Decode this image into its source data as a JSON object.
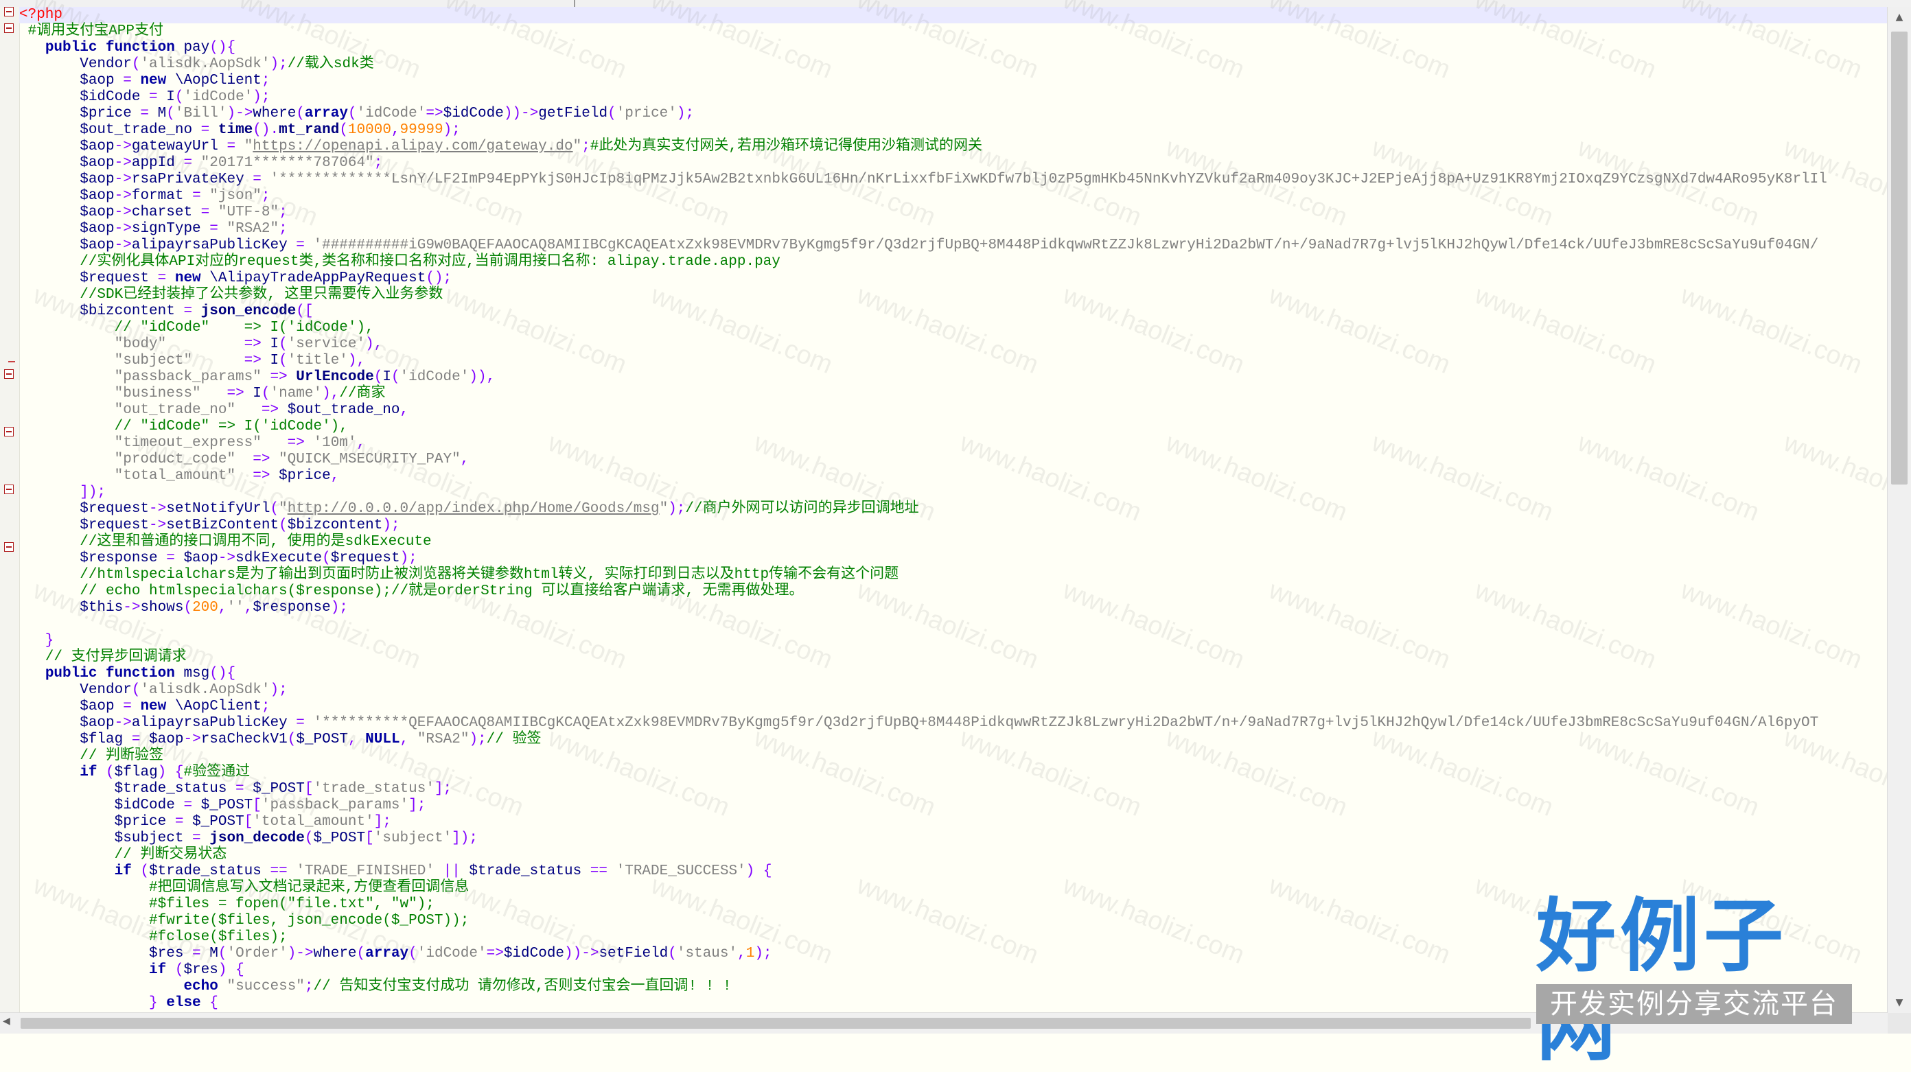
{
  "editor": {
    "language": "php",
    "lines": [
      [
        [
          "tag",
          "<?php"
        ]
      ],
      [
        [
          "com",
          " #调用支付宝APP支付"
        ]
      ],
      [
        [
          "plain",
          "   "
        ],
        [
          "kw",
          "public function"
        ],
        [
          "plain",
          " pay"
        ],
        [
          "op",
          "(){"
        ]
      ],
      [
        [
          "plain",
          "       Vendor"
        ],
        [
          "op",
          "("
        ],
        [
          "str",
          "'alisdk.AopSdk'"
        ],
        [
          "op",
          ");"
        ],
        [
          "com",
          "//载入sdk类"
        ]
      ],
      [
        [
          "var",
          "       $aop"
        ],
        [
          "op",
          " = "
        ],
        [
          "kw",
          "new"
        ],
        [
          "plain",
          " \\AopClient"
        ],
        [
          "op",
          ";"
        ]
      ],
      [
        [
          "var",
          "       $idCode"
        ],
        [
          "op",
          " = "
        ],
        [
          "plain",
          "I"
        ],
        [
          "op",
          "("
        ],
        [
          "str",
          "'idCode'"
        ],
        [
          "op",
          ");"
        ]
      ],
      [
        [
          "var",
          "       $price"
        ],
        [
          "op",
          " = "
        ],
        [
          "plain",
          "M"
        ],
        [
          "op",
          "("
        ],
        [
          "str",
          "'Bill'"
        ],
        [
          "op",
          ")->"
        ],
        [
          "plain",
          "where"
        ],
        [
          "op",
          "("
        ],
        [
          "kw",
          "array"
        ],
        [
          "op",
          "("
        ],
        [
          "str",
          "'idCode'"
        ],
        [
          "op",
          "=>"
        ],
        [
          "var",
          "$idCode"
        ],
        [
          "op",
          "))->"
        ],
        [
          "plain",
          "getField"
        ],
        [
          "op",
          "("
        ],
        [
          "str",
          "'price'"
        ],
        [
          "op",
          ");"
        ]
      ],
      [
        [
          "var",
          "       $out_trade_no"
        ],
        [
          "op",
          " = "
        ],
        [
          "fn",
          "time"
        ],
        [
          "op",
          "()."
        ],
        [
          "fn",
          "mt_rand"
        ],
        [
          "op",
          "("
        ],
        [
          "num",
          "10000"
        ],
        [
          "op",
          ","
        ],
        [
          "num",
          "99999"
        ],
        [
          "op",
          ");"
        ]
      ],
      [
        [
          "var",
          "       $aop"
        ],
        [
          "op",
          "->"
        ],
        [
          "plain",
          "gatewayUrl"
        ],
        [
          "op",
          " = "
        ],
        [
          "str",
          "\""
        ],
        [
          "url",
          "https://openapi.alipay.com/gateway.do"
        ],
        [
          "str",
          "\""
        ],
        [
          "op",
          ";"
        ],
        [
          "com",
          "#此处为真实支付网关,若用沙箱环境记得使用沙箱测试的网关"
        ]
      ],
      [
        [
          "var",
          "       $aop"
        ],
        [
          "op",
          "->"
        ],
        [
          "plain",
          "appId"
        ],
        [
          "op",
          " = "
        ],
        [
          "str",
          "\"20171*******787064\""
        ],
        [
          "op",
          ";"
        ]
      ],
      [
        [
          "var",
          "       $aop"
        ],
        [
          "op",
          "->"
        ],
        [
          "plain",
          "rsaPrivateKey"
        ],
        [
          "op",
          " = "
        ],
        [
          "str",
          "'*************LsnY/LF2ImP94EpPYkjS0HJcIp8iqPMzJjk5Aw2B2txnbkG6UL16Hn/nKrLixxfbFiXwKDfw7blj0zP5gmHKb45NnKvhYZVkuf2aRm409oy3KJC+J2EPjeAjj8pA+Uz91KR8Ymj2IOxqZ9YCzsgNXd7dw4ARo95yK8rlIl"
        ]
      ],
      [
        [
          "var",
          "       $aop"
        ],
        [
          "op",
          "->"
        ],
        [
          "plain",
          "format"
        ],
        [
          "op",
          " = "
        ],
        [
          "str",
          "\"json\""
        ],
        [
          "op",
          ";"
        ]
      ],
      [
        [
          "var",
          "       $aop"
        ],
        [
          "op",
          "->"
        ],
        [
          "plain",
          "charset"
        ],
        [
          "op",
          " = "
        ],
        [
          "str",
          "\"UTF-8\""
        ],
        [
          "op",
          ";"
        ]
      ],
      [
        [
          "var",
          "       $aop"
        ],
        [
          "op",
          "->"
        ],
        [
          "plain",
          "signType"
        ],
        [
          "op",
          " = "
        ],
        [
          "str",
          "\"RSA2\""
        ],
        [
          "op",
          ";"
        ]
      ],
      [
        [
          "var",
          "       $aop"
        ],
        [
          "op",
          "->"
        ],
        [
          "plain",
          "alipayrsaPublicKey"
        ],
        [
          "op",
          " = "
        ],
        [
          "str",
          "'##########iG9w0BAQEFAAOCAQ8AMIIBCgKCAQEAtxZxk98EVMDRv7ByKgmg5f9r/Q3d2rjfUpBQ+8M448PidkqwwRtZZJk8LzwryHi2Da2bWT/n+/9aNad7R7g+lvj5lKHJ2hQywl/Dfe14ck/UUfeJ3bmRE8cScSaYu9uf04GN/"
        ]
      ],
      [
        [
          "com",
          "       //实例化具体API对应的request类,类名称和接口名称对应,当前调用接口名称: alipay.trade.app.pay"
        ]
      ],
      [
        [
          "var",
          "       $request"
        ],
        [
          "op",
          " = "
        ],
        [
          "kw",
          "new"
        ],
        [
          "plain",
          " \\AlipayTradeAppPayRequest"
        ],
        [
          "op",
          "();"
        ]
      ],
      [
        [
          "com",
          "       //SDK已经封装掉了公共参数, 这里只需要传入业务参数"
        ]
      ],
      [
        [
          "var",
          "       $bizcontent"
        ],
        [
          "op",
          " = "
        ],
        [
          "fn",
          "json_encode"
        ],
        [
          "op",
          "(["
        ]
      ],
      [
        [
          "com",
          "           // \"idCode\"    => I('idCode'),"
        ]
      ],
      [
        [
          "str",
          "           \"body\""
        ],
        [
          "op",
          "         => "
        ],
        [
          "plain",
          "I"
        ],
        [
          "op",
          "("
        ],
        [
          "str",
          "'service'"
        ],
        [
          "op",
          "),"
        ]
      ],
      [
        [
          "str",
          "           \"subject\""
        ],
        [
          "op",
          "      => "
        ],
        [
          "plain",
          "I"
        ],
        [
          "op",
          "("
        ],
        [
          "str",
          "'title'"
        ],
        [
          "op",
          "),"
        ]
      ],
      [
        [
          "str",
          "           \"passback_params\""
        ],
        [
          "op",
          " => "
        ],
        [
          "fn",
          "UrlEncode"
        ],
        [
          "op",
          "("
        ],
        [
          "plain",
          "I"
        ],
        [
          "op",
          "("
        ],
        [
          "str",
          "'idCode'"
        ],
        [
          "op",
          ")),"
        ]
      ],
      [
        [
          "str",
          "           \"business\""
        ],
        [
          "op",
          "   => "
        ],
        [
          "plain",
          "I"
        ],
        [
          "op",
          "("
        ],
        [
          "str",
          "'name'"
        ],
        [
          "op",
          "),"
        ],
        [
          "com",
          "//商家"
        ]
      ],
      [
        [
          "str",
          "           \"out_trade_no\""
        ],
        [
          "op",
          "   => "
        ],
        [
          "var",
          "$out_trade_no"
        ],
        [
          "op",
          ","
        ]
      ],
      [
        [
          "com",
          "           // \"idCode\" => I('idCode'),"
        ]
      ],
      [
        [
          "str",
          "           \"timeout_express\""
        ],
        [
          "op",
          "   => "
        ],
        [
          "str",
          "'10m'"
        ],
        [
          "op",
          ","
        ]
      ],
      [
        [
          "str",
          "           \"product_code\""
        ],
        [
          "op",
          "  => "
        ],
        [
          "str",
          "\"QUICK_MSECURITY_PAY\""
        ],
        [
          "op",
          ","
        ]
      ],
      [
        [
          "str",
          "           \"total_amount\""
        ],
        [
          "op",
          "  => "
        ],
        [
          "var",
          "$price"
        ],
        [
          "op",
          ","
        ]
      ],
      [
        [
          "op",
          "       ]);"
        ]
      ],
      [
        [
          "var",
          "       $request"
        ],
        [
          "op",
          "->"
        ],
        [
          "plain",
          "setNotifyUrl"
        ],
        [
          "op",
          "("
        ],
        [
          "str",
          "\""
        ],
        [
          "url",
          "http://0.0.0.0/app/index.php/Home/Goods/msg"
        ],
        [
          "str",
          "\""
        ],
        [
          "op",
          ");"
        ],
        [
          "com",
          "//商户外网可以访问的异步回调地址"
        ]
      ],
      [
        [
          "var",
          "       $request"
        ],
        [
          "op",
          "->"
        ],
        [
          "plain",
          "setBizContent"
        ],
        [
          "op",
          "("
        ],
        [
          "var",
          "$bizcontent"
        ],
        [
          "op",
          ");"
        ]
      ],
      [
        [
          "com",
          "       //这里和普通的接口调用不同, 使用的是sdkExecute"
        ]
      ],
      [
        [
          "var",
          "       $response"
        ],
        [
          "op",
          " = "
        ],
        [
          "var",
          "$aop"
        ],
        [
          "op",
          "->"
        ],
        [
          "plain",
          "sdkExecute"
        ],
        [
          "op",
          "("
        ],
        [
          "var",
          "$request"
        ],
        [
          "op",
          ");"
        ]
      ],
      [
        [
          "com",
          "       //htmlspecialchars是为了输出到页面时防止被浏览器将关键参数html转义, 实际打印到日志以及http传输不会有这个问题"
        ]
      ],
      [
        [
          "com",
          "       // echo htmlspecialchars($response);//就是orderString 可以直接给客户端请求, 无需再做处理。"
        ]
      ],
      [
        [
          "var",
          "       $this"
        ],
        [
          "op",
          "->"
        ],
        [
          "plain",
          "shows"
        ],
        [
          "op",
          "("
        ],
        [
          "num",
          "200"
        ],
        [
          "op",
          ","
        ],
        [
          "str",
          "''"
        ],
        [
          "op",
          ","
        ],
        [
          "var",
          "$response"
        ],
        [
          "op",
          ");"
        ]
      ],
      [
        [
          "plain",
          " "
        ]
      ],
      [
        [
          "op",
          "   }"
        ]
      ],
      [
        [
          "com",
          "   // 支付异步回调请求"
        ]
      ],
      [
        [
          "plain",
          "   "
        ],
        [
          "kw",
          "public function"
        ],
        [
          "plain",
          " msg"
        ],
        [
          "op",
          "(){"
        ]
      ],
      [
        [
          "plain",
          "       Vendor"
        ],
        [
          "op",
          "("
        ],
        [
          "str",
          "'alisdk.AopSdk'"
        ],
        [
          "op",
          ");"
        ]
      ],
      [
        [
          "var",
          "       $aop"
        ],
        [
          "op",
          " = "
        ],
        [
          "kw",
          "new"
        ],
        [
          "plain",
          " \\AopClient"
        ],
        [
          "op",
          ";"
        ]
      ],
      [
        [
          "var",
          "       $aop"
        ],
        [
          "op",
          "->"
        ],
        [
          "plain",
          "alipayrsaPublicKey"
        ],
        [
          "op",
          " = "
        ],
        [
          "str",
          "'**********QEFAAOCAQ8AMIIBCgKCAQEAtxZxk98EVMDRv7ByKgmg5f9r/Q3d2rjfUpBQ+8M448PidkqwwRtZZJk8LzwryHi2Da2bWT/n+/9aNad7R7g+lvj5lKHJ2hQywl/Dfe14ck/UUfeJ3bmRE8cScSaYu9uf04GN/Al6pyOT"
        ]
      ],
      [
        [
          "var",
          "       $flag"
        ],
        [
          "op",
          " = "
        ],
        [
          "var",
          "$aop"
        ],
        [
          "op",
          "->"
        ],
        [
          "plain",
          "rsaCheckV1"
        ],
        [
          "op",
          "("
        ],
        [
          "var",
          "$_POST"
        ],
        [
          "op",
          ", "
        ],
        [
          "kw",
          "NULL"
        ],
        [
          "op",
          ", "
        ],
        [
          "str",
          "\"RSA2\""
        ],
        [
          "op",
          ");"
        ],
        [
          "com",
          "// 验签"
        ]
      ],
      [
        [
          "com",
          "       // 判断验签"
        ]
      ],
      [
        [
          "plain",
          "       "
        ],
        [
          "kw",
          "if"
        ],
        [
          "op",
          " ("
        ],
        [
          "var",
          "$flag"
        ],
        [
          "op",
          ") {"
        ],
        [
          "com",
          "#验签通过"
        ]
      ],
      [
        [
          "var",
          "           $trade_status"
        ],
        [
          "op",
          " = "
        ],
        [
          "var",
          "$_POST"
        ],
        [
          "op",
          "["
        ],
        [
          "str",
          "'trade_status'"
        ],
        [
          "op",
          "];"
        ]
      ],
      [
        [
          "var",
          "           $idCode"
        ],
        [
          "op",
          " = "
        ],
        [
          "var",
          "$_POST"
        ],
        [
          "op",
          "["
        ],
        [
          "str",
          "'passback_params'"
        ],
        [
          "op",
          "];"
        ]
      ],
      [
        [
          "var",
          "           $price"
        ],
        [
          "op",
          " = "
        ],
        [
          "var",
          "$_POST"
        ],
        [
          "op",
          "["
        ],
        [
          "str",
          "'total_amount'"
        ],
        [
          "op",
          "];"
        ]
      ],
      [
        [
          "var",
          "           $subject"
        ],
        [
          "op",
          " = "
        ],
        [
          "fn",
          "json_decode"
        ],
        [
          "op",
          "("
        ],
        [
          "var",
          "$_POST"
        ],
        [
          "op",
          "["
        ],
        [
          "str",
          "'subject'"
        ],
        [
          "op",
          "]);"
        ]
      ],
      [
        [
          "com",
          "           // 判断交易状态"
        ]
      ],
      [
        [
          "plain",
          "           "
        ],
        [
          "kw",
          "if"
        ],
        [
          "op",
          " ("
        ],
        [
          "var",
          "$trade_status"
        ],
        [
          "op",
          " == "
        ],
        [
          "str",
          "'TRADE_FINISHED'"
        ],
        [
          "op",
          " || "
        ],
        [
          "var",
          "$trade_status"
        ],
        [
          "op",
          " == "
        ],
        [
          "str",
          "'TRADE_SUCCESS'"
        ],
        [
          "op",
          ") {"
        ]
      ],
      [
        [
          "com",
          "               #把回调信息写入文档记录起来,方便查看回调信息"
        ]
      ],
      [
        [
          "com",
          "               #$files = fopen(\"file.txt\", \"w\");"
        ]
      ],
      [
        [
          "com",
          "               #fwrite($files, json_encode($_POST));"
        ]
      ],
      [
        [
          "com",
          "               #fclose($files);"
        ]
      ],
      [
        [
          "var",
          "               $res"
        ],
        [
          "op",
          " = "
        ],
        [
          "plain",
          "M"
        ],
        [
          "op",
          "("
        ],
        [
          "str",
          "'Order'"
        ],
        [
          "op",
          ")->"
        ],
        [
          "plain",
          "where"
        ],
        [
          "op",
          "("
        ],
        [
          "kw",
          "array"
        ],
        [
          "op",
          "("
        ],
        [
          "str",
          "'idCode'"
        ],
        [
          "op",
          "=>"
        ],
        [
          "var",
          "$idCode"
        ],
        [
          "op",
          "))->"
        ],
        [
          "plain",
          "setField"
        ],
        [
          "op",
          "("
        ],
        [
          "str",
          "'staus'"
        ],
        [
          "op",
          ","
        ],
        [
          "num",
          "1"
        ],
        [
          "op",
          ");"
        ]
      ],
      [
        [
          "plain",
          "               "
        ],
        [
          "kw",
          "if"
        ],
        [
          "op",
          " ("
        ],
        [
          "var",
          "$res"
        ],
        [
          "op",
          ") {"
        ]
      ],
      [
        [
          "plain",
          "                   "
        ],
        [
          "kw",
          "echo"
        ],
        [
          "str",
          " \"success\""
        ],
        [
          "op",
          ";"
        ],
        [
          "com",
          "// 告知支付宝支付成功 请勿修改,否则支付宝会一直回调! ! !"
        ]
      ],
      [
        [
          "op",
          "               } "
        ],
        [
          "kw",
          "else"
        ],
        [
          "op",
          " {"
        ]
      ]
    ]
  },
  "watermark": {
    "text": "www.haolizi.com"
  },
  "logo": {
    "title": "好例子网",
    "subtitle": "开发实例分享交流平台",
    "title_color": "#2a80d8",
    "bar_color": "#a7a7a7"
  },
  "scrollbars": {
    "up_icon": "▲",
    "down_icon": "▼",
    "left_icon": "◀"
  }
}
